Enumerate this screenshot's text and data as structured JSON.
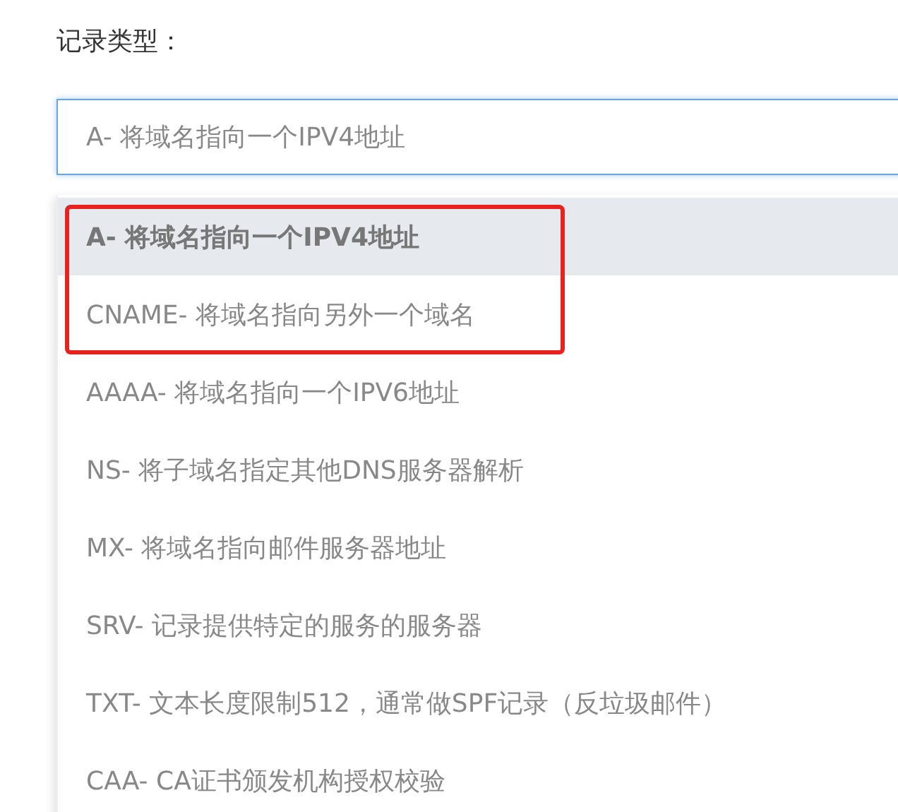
{
  "field": {
    "label": "记录类型：",
    "value": "A- 将域名指向一个IPV4地址",
    "focused": true
  },
  "dropdown": {
    "options": [
      {
        "label": "A- 将域名指向一个IPV4地址",
        "selected": true,
        "annotated": true
      },
      {
        "label": "CNAME- 将域名指向另外一个域名",
        "selected": false,
        "annotated": true
      },
      {
        "label": "AAAA- 将域名指向一个IPV6地址",
        "selected": false,
        "annotated": false
      },
      {
        "label": "NS- 将子域名指定其他DNS服务器解析",
        "selected": false,
        "annotated": false
      },
      {
        "label": "MX- 将域名指向邮件服务器地址",
        "selected": false,
        "annotated": false
      },
      {
        "label": "SRV- 记录提供特定的服务的服务器",
        "selected": false,
        "annotated": false
      },
      {
        "label": "TXT- 文本长度限制512，通常做SPF记录（反垃圾邮件）",
        "selected": false,
        "annotated": false
      },
      {
        "label": "CAA- CA证书颁发机构授权校验",
        "selected": false,
        "annotated": false
      }
    ]
  }
}
